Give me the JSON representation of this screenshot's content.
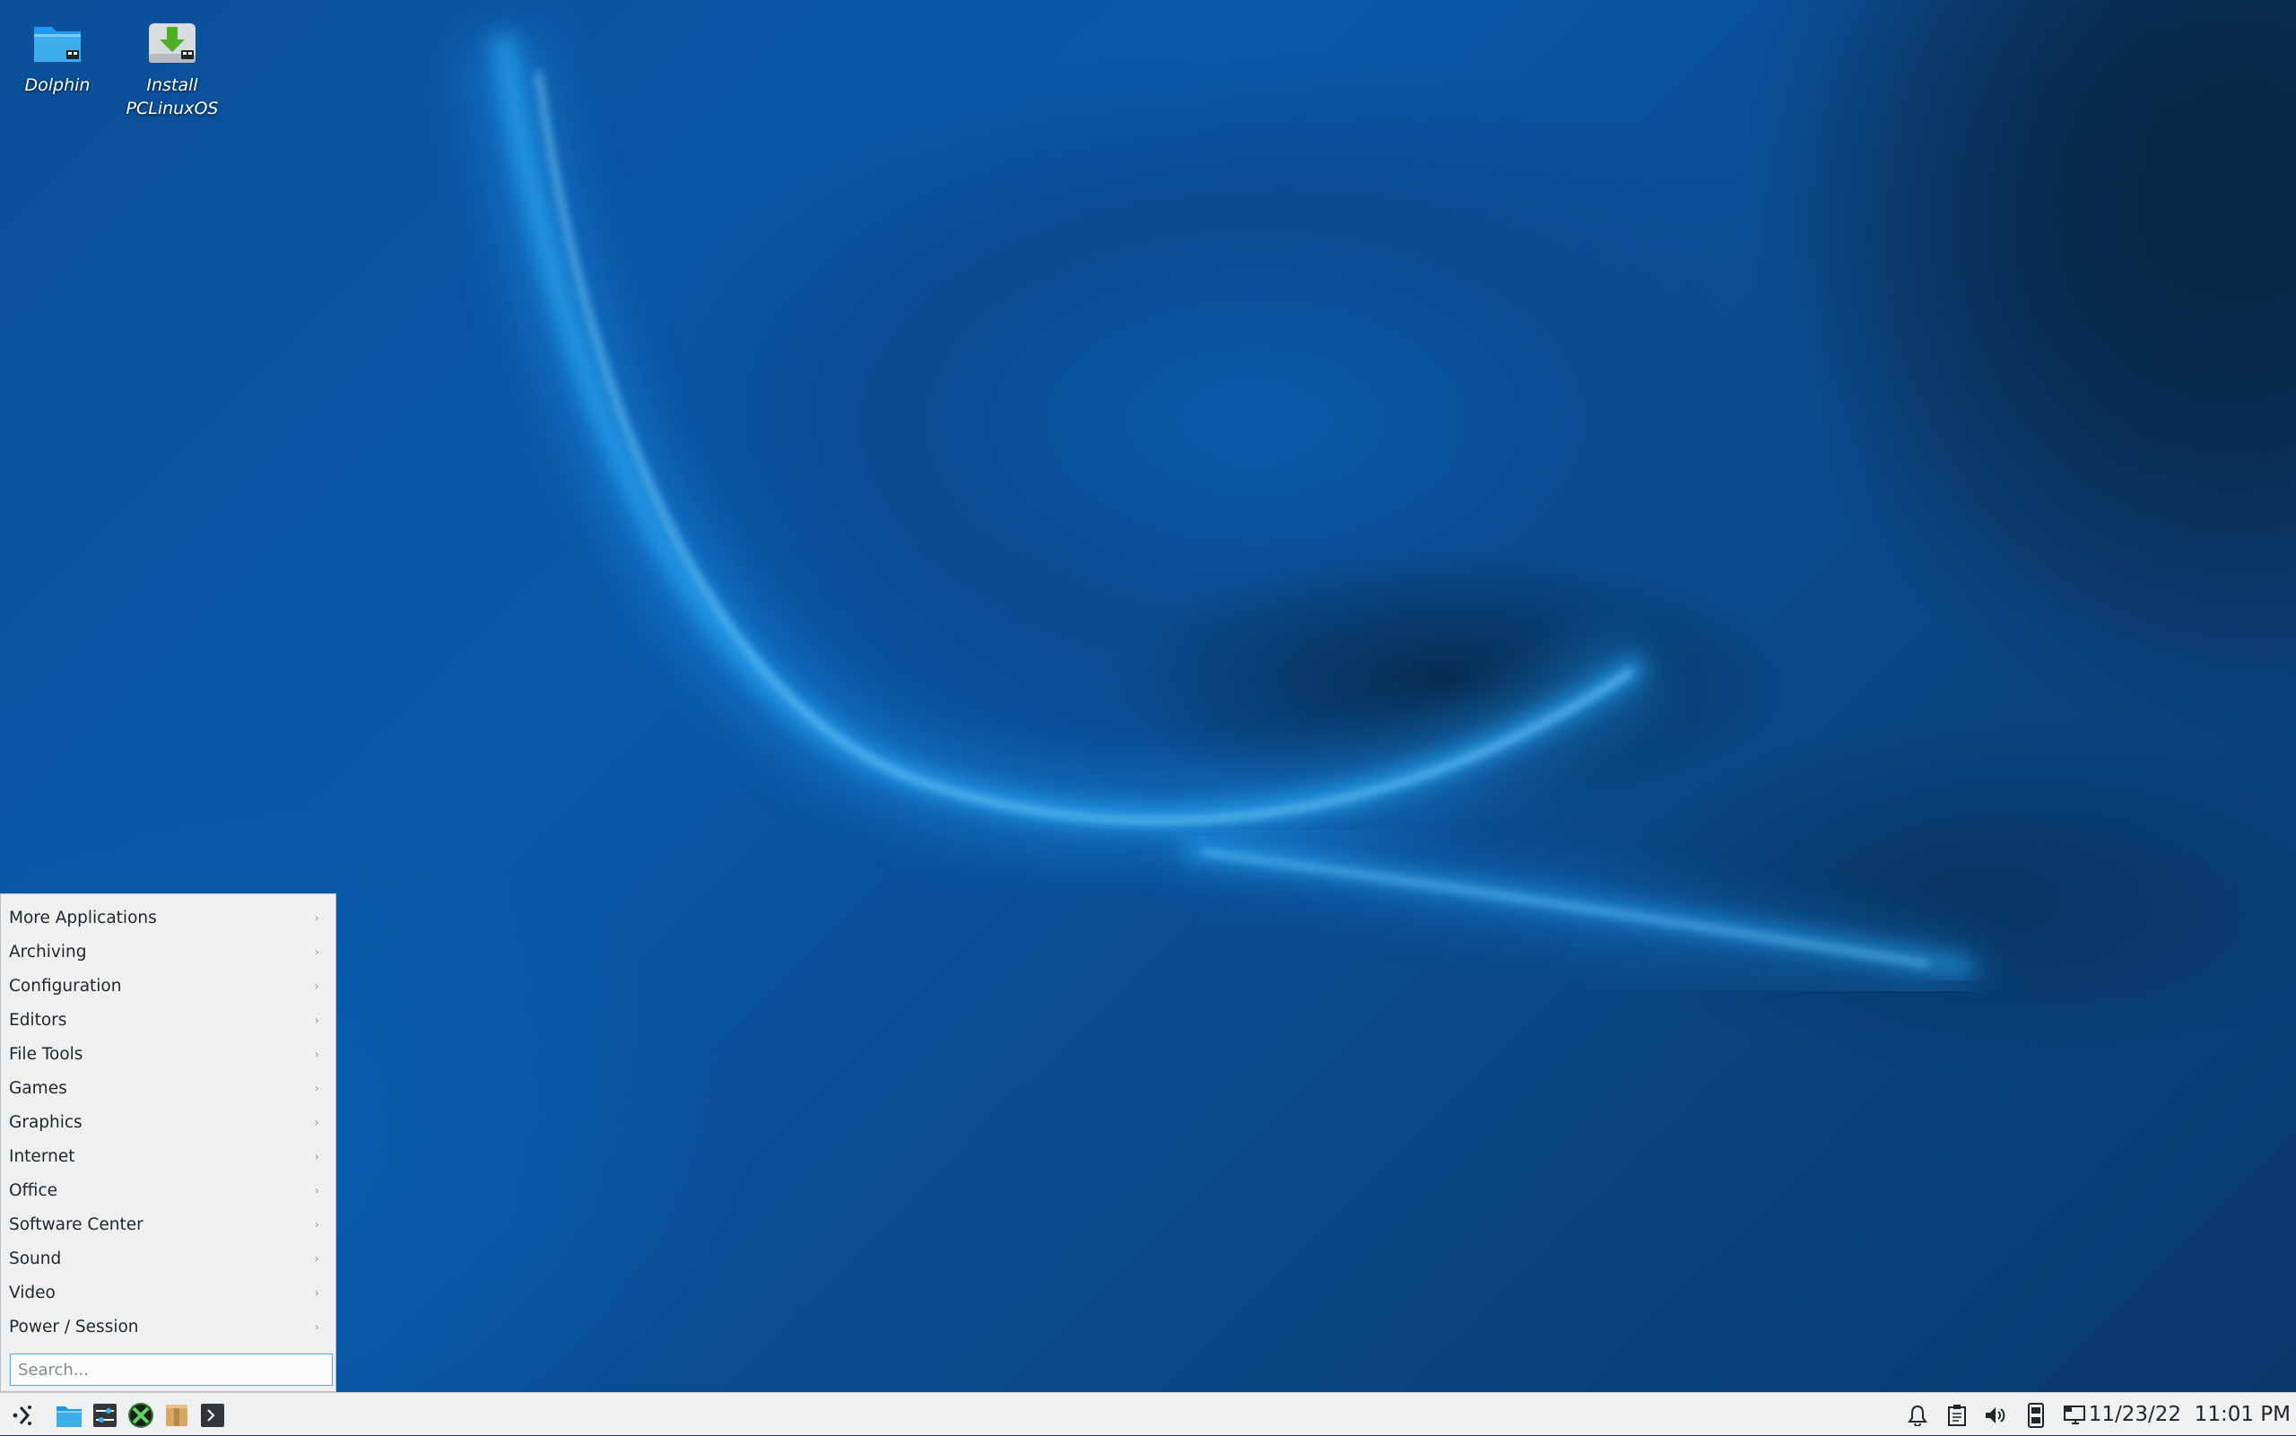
{
  "desktop": {
    "icons": [
      {
        "label": "Dolphin",
        "icon": "folder-icon"
      },
      {
        "label_line1": "Install",
        "label_line2": "PCLinuxOS",
        "icon": "install-disk-icon"
      }
    ]
  },
  "menu": {
    "items": [
      {
        "label": "More Applications"
      },
      {
        "label": "Archiving"
      },
      {
        "label": "Configuration"
      },
      {
        "label": "Editors"
      },
      {
        "label": "File Tools"
      },
      {
        "label": "Games"
      },
      {
        "label": "Graphics"
      },
      {
        "label": "Internet"
      },
      {
        "label": "Office"
      },
      {
        "label": "Software Center"
      },
      {
        "label": "Sound"
      },
      {
        "label": "Video"
      },
      {
        "label": "Power / Session"
      }
    ],
    "chevron": "›",
    "search_placeholder": "Search..."
  },
  "taskbar": {
    "launchers": [
      "app-launcher-icon",
      "file-manager-icon",
      "system-settings-icon",
      "xbox-icon",
      "archive-icon",
      "terminal-icon"
    ],
    "tray": [
      "notifications-icon",
      "clipboard-icon",
      "volume-icon",
      "removable-device-icon",
      "display-icon"
    ],
    "clock": "11/23/22  11:01 PM"
  },
  "colors": {
    "accent": "#3daee9",
    "panel_bg": "#eff0f1",
    "text": "#232629"
  }
}
